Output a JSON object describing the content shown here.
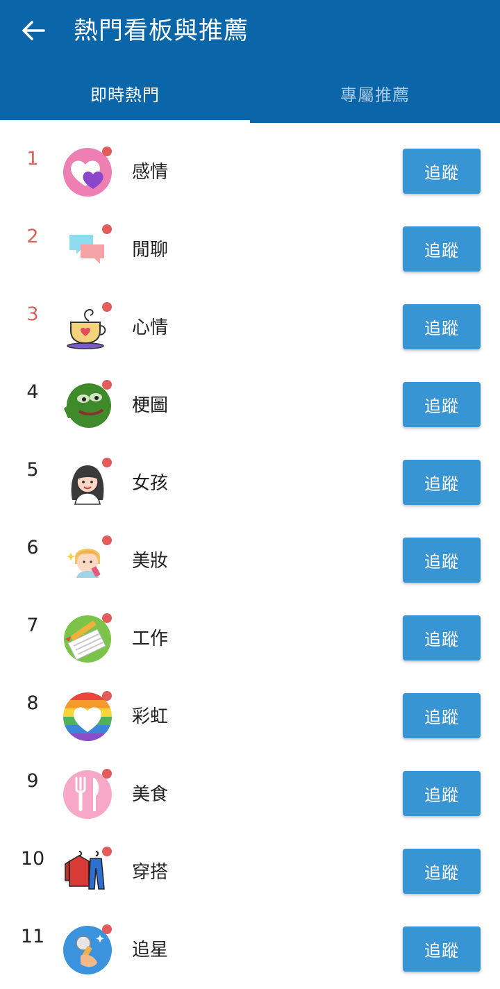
{
  "header": {
    "title": "熱門看板與推薦",
    "back_icon": "arrow-left-icon"
  },
  "tabs": [
    {
      "label": "即時熱門",
      "active": true
    },
    {
      "label": "專屬推薦",
      "active": false
    }
  ],
  "boards": [
    {
      "rank": "1",
      "name": "感情",
      "icon": "heart-icon",
      "button": "追蹤",
      "unread": true
    },
    {
      "rank": "2",
      "name": "閒聊",
      "icon": "chat-bubbles-icon",
      "button": "追蹤",
      "unread": true
    },
    {
      "rank": "3",
      "name": "心情",
      "icon": "coffee-cup-icon",
      "button": "追蹤",
      "unread": true
    },
    {
      "rank": "4",
      "name": "梗圖",
      "icon": "frog-meme-icon",
      "button": "追蹤",
      "unread": true
    },
    {
      "rank": "5",
      "name": "女孩",
      "icon": "girl-icon",
      "button": "追蹤",
      "unread": true
    },
    {
      "rank": "6",
      "name": "美妝",
      "icon": "makeup-icon",
      "button": "追蹤",
      "unread": true
    },
    {
      "rank": "7",
      "name": "工作",
      "icon": "pencil-notebook-icon",
      "button": "追蹤",
      "unread": true
    },
    {
      "rank": "8",
      "name": "彩虹",
      "icon": "rainbow-heart-icon",
      "button": "追蹤",
      "unread": true
    },
    {
      "rank": "9",
      "name": "美食",
      "icon": "fork-knife-icon",
      "button": "追蹤",
      "unread": true
    },
    {
      "rank": "10",
      "name": "穿搭",
      "icon": "clothes-hanger-icon",
      "button": "追蹤",
      "unread": true
    },
    {
      "rank": "11",
      "name": "追星",
      "icon": "microphone-icon",
      "button": "追蹤",
      "unread": true
    }
  ],
  "colors": {
    "appbar": "#0a66a8",
    "tab_inactive": "#a9c9e4",
    "button": "#3895d3",
    "top_rank": "#d9625a",
    "unread_dot": "#e25c5c"
  }
}
